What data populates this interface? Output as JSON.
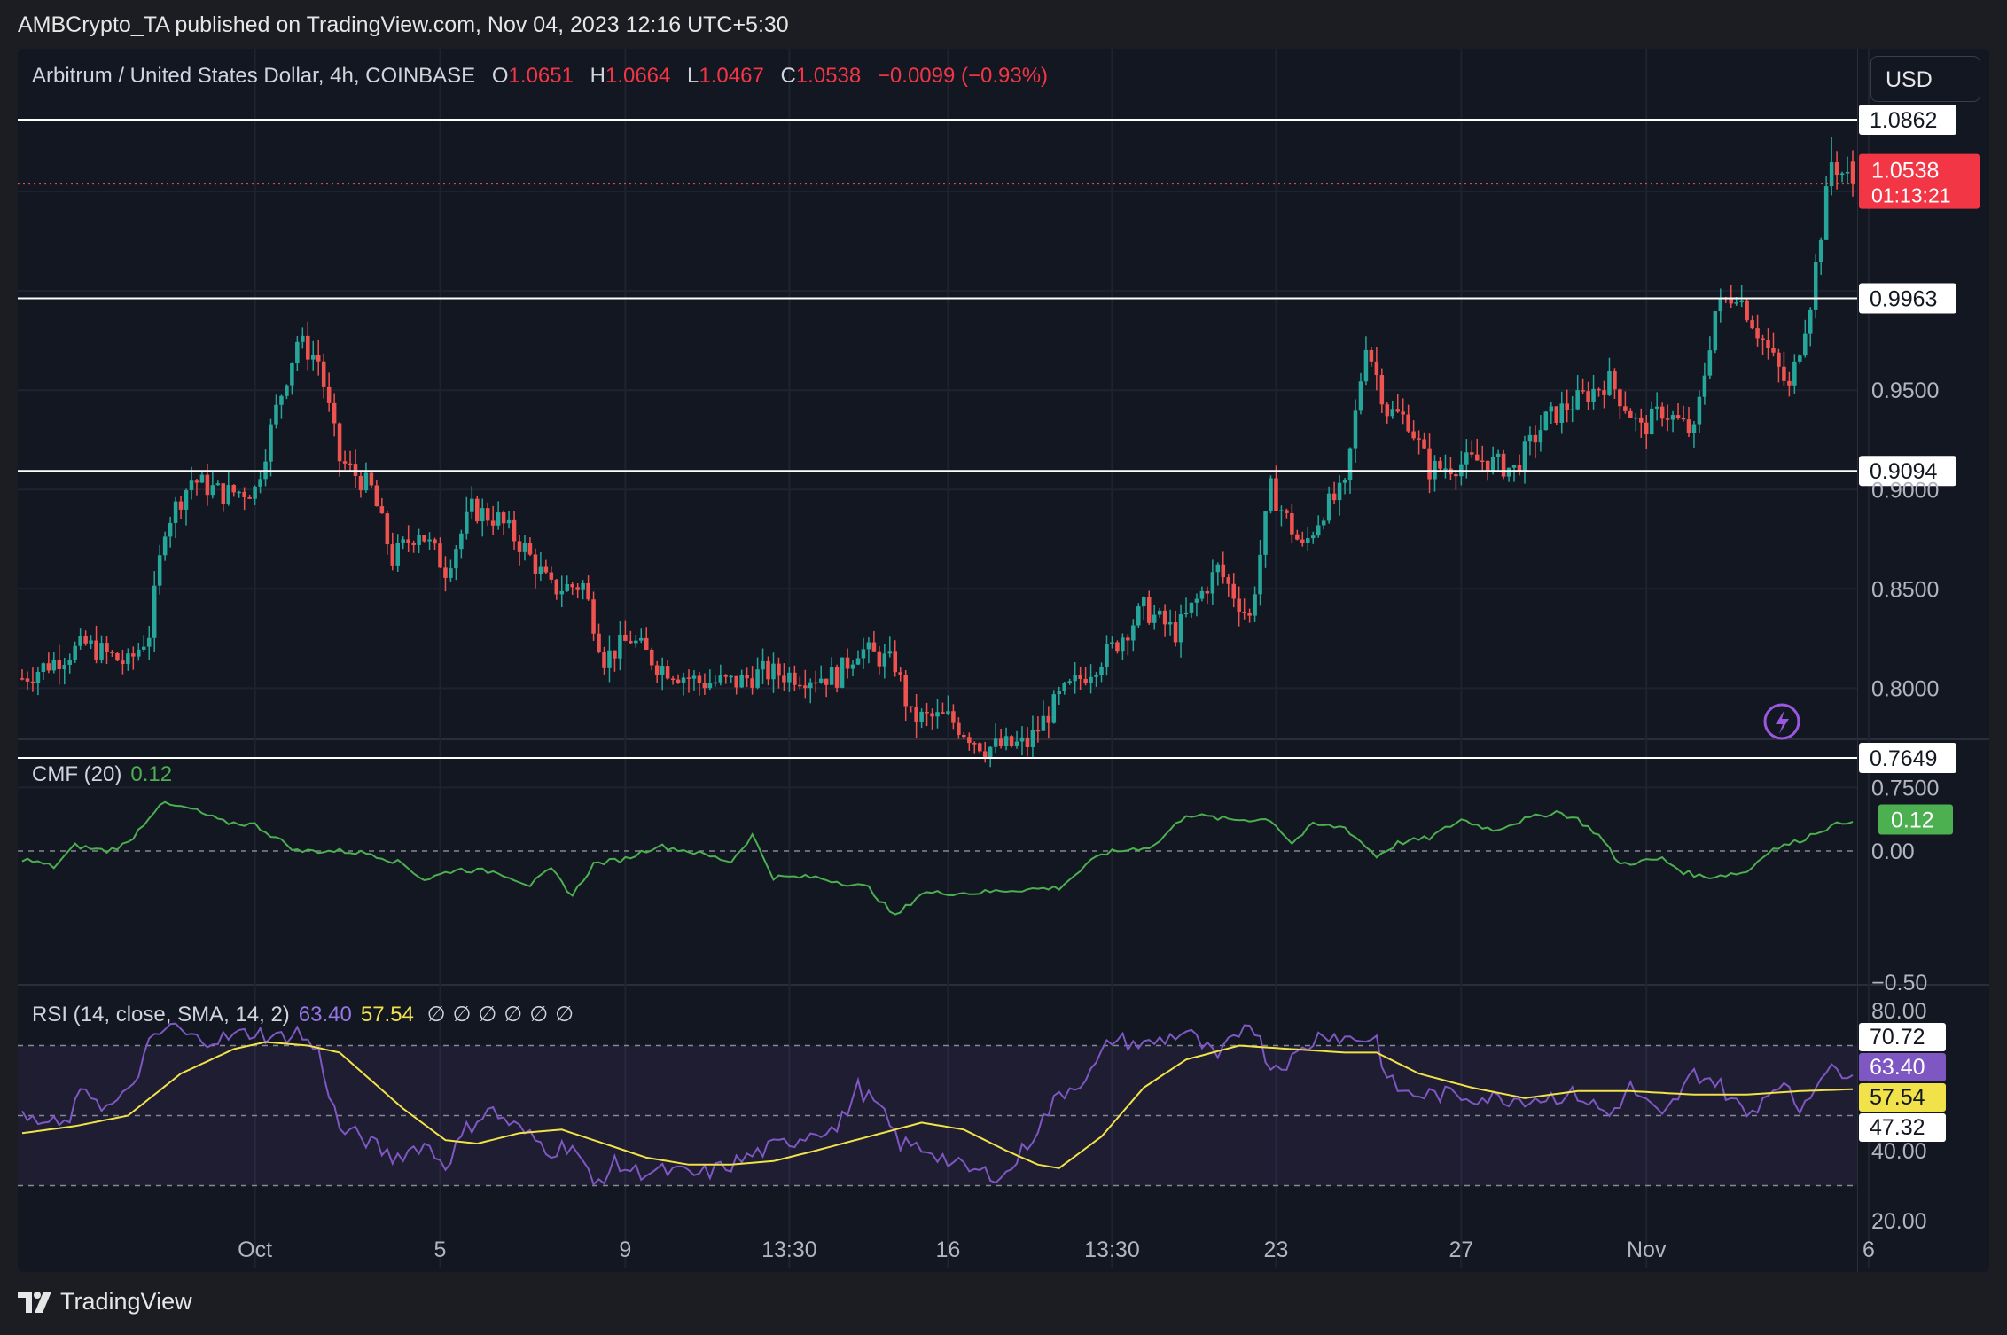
{
  "header": {
    "publisher": "AMBCrypto_TA published on TradingView.com, Nov 04, 2023 12:16 UTC+5:30"
  },
  "legend": {
    "symbol": "Arbitrum / United States Dollar, 4h, COINBASE",
    "open_label": "O",
    "open": "1.0651",
    "high_label": "H",
    "high": "1.0664",
    "low_label": "L",
    "low": "1.0467",
    "close_label": "C",
    "close": "1.0538",
    "change": "−0.0099 (−0.93%)"
  },
  "currency": "USD",
  "price_tag": {
    "price": "1.0538",
    "countdown": "01:13:21"
  },
  "levels": [
    "1.0862",
    "0.9963",
    "0.9094",
    "0.7649"
  ],
  "cmf": {
    "label": "CMF (20)",
    "value": "0.12",
    "axis": [
      "0.00",
      "−0.50"
    ]
  },
  "rsi": {
    "label": "RSI (14, close, SMA, 14, 2)",
    "value": "63.40",
    "sma": "57.54",
    "na_marks": [
      "∅",
      "∅",
      "∅",
      "∅",
      "∅",
      "∅"
    ],
    "tags": {
      "upper": "70.72",
      "rsi": "63.40",
      "sma": "57.54",
      "lower": "47.32"
    },
    "axis": [
      "80.00",
      "40.00",
      "20.00"
    ]
  },
  "footer": {
    "brand": "TradingView"
  },
  "colors": {
    "up": "#26a69a",
    "down": "#ef5350",
    "cmf": "#4caf50",
    "rsi": "#7e57c2",
    "sma": "#f2e24a",
    "bg": "#131722"
  },
  "chart_data": {
    "type": "candlestick",
    "interval": "4h",
    "y_ticks": [
      "0.7500",
      "0.8000",
      "0.8500",
      "0.9000",
      "0.9500"
    ],
    "x_ticks": [
      "Oct",
      "5",
      "9",
      "13:30",
      "16",
      "13:30",
      "23",
      "27",
      "Nov",
      "6"
    ],
    "price_range": [
      0.735,
      1.1
    ],
    "cmf_range": [
      -0.5,
      0.25
    ],
    "rsi_range": [
      20,
      80
    ],
    "key_levels": [
      1.0862,
      0.9963,
      0.9094,
      0.7649
    ],
    "close_path": [
      [
        0,
        0.805
      ],
      [
        12,
        0.822
      ],
      [
        20,
        0.812
      ],
      [
        24,
        0.828
      ],
      [
        27,
        0.882
      ],
      [
        32,
        0.905
      ],
      [
        38,
        0.898
      ],
      [
        44,
        0.9
      ],
      [
        48,
        0.94
      ],
      [
        52,
        0.975
      ],
      [
        56,
        0.965
      ],
      [
        60,
        0.915
      ],
      [
        66,
        0.9
      ],
      [
        70,
        0.865
      ],
      [
        75,
        0.88
      ],
      [
        80,
        0.86
      ],
      [
        85,
        0.89
      ],
      [
        90,
        0.885
      ],
      [
        95,
        0.87
      ],
      [
        100,
        0.85
      ],
      [
        106,
        0.852
      ],
      [
        110,
        0.815
      ],
      [
        115,
        0.825
      ],
      [
        120,
        0.812
      ],
      [
        128,
        0.803
      ],
      [
        135,
        0.803
      ],
      [
        140,
        0.808
      ],
      [
        148,
        0.806
      ],
      [
        154,
        0.806
      ],
      [
        158,
        0.82
      ],
      [
        165,
        0.812
      ],
      [
        168,
        0.785
      ],
      [
        175,
        0.785
      ],
      [
        182,
        0.77
      ],
      [
        190,
        0.772
      ],
      [
        196,
        0.795
      ],
      [
        206,
        0.82
      ],
      [
        212,
        0.84
      ],
      [
        218,
        0.828
      ],
      [
        226,
        0.86
      ],
      [
        232,
        0.835
      ],
      [
        236,
        0.9
      ],
      [
        242,
        0.87
      ],
      [
        246,
        0.89
      ],
      [
        250,
        0.9
      ],
      [
        254,
        0.975
      ],
      [
        258,
        0.94
      ],
      [
        262,
        0.935
      ],
      [
        266,
        0.91
      ],
      [
        270,
        0.912
      ],
      [
        276,
        0.915
      ],
      [
        282,
        0.91
      ],
      [
        288,
        0.935
      ],
      [
        294,
        0.945
      ],
      [
        300,
        0.955
      ],
      [
        306,
        0.93
      ],
      [
        310,
        0.94
      ],
      [
        316,
        0.928
      ],
      [
        320,
        0.99
      ],
      [
        324,
        1.0
      ],
      [
        328,
        0.98
      ],
      [
        334,
        0.95
      ],
      [
        338,
        0.995
      ],
      [
        342,
        1.065
      ],
      [
        346,
        1.0538
      ]
    ],
    "cmf_path": [
      [
        0,
        -0.03
      ],
      [
        6,
        -0.06
      ],
      [
        10,
        0.02
      ],
      [
        16,
        0.0
      ],
      [
        20,
        0.03
      ],
      [
        26,
        0.18
      ],
      [
        32,
        0.16
      ],
      [
        38,
        0.11
      ],
      [
        44,
        0.1
      ],
      [
        52,
        0.0
      ],
      [
        60,
        0.0
      ],
      [
        66,
        -0.01
      ],
      [
        72,
        -0.05
      ],
      [
        76,
        -0.11
      ],
      [
        82,
        -0.07
      ],
      [
        90,
        -0.08
      ],
      [
        96,
        -0.13
      ],
      [
        100,
        -0.07
      ],
      [
        104,
        -0.17
      ],
      [
        108,
        -0.05
      ],
      [
        114,
        -0.03
      ],
      [
        120,
        0.02
      ],
      [
        126,
        0.0
      ],
      [
        134,
        -0.04
      ],
      [
        138,
        0.06
      ],
      [
        142,
        -0.1
      ],
      [
        150,
        -0.1
      ],
      [
        160,
        -0.14
      ],
      [
        165,
        -0.25
      ],
      [
        170,
        -0.16
      ],
      [
        180,
        -0.16
      ],
      [
        186,
        -0.15
      ],
      [
        196,
        -0.14
      ],
      [
        204,
        -0.01
      ],
      [
        214,
        0.02
      ],
      [
        220,
        0.14
      ],
      [
        228,
        0.12
      ],
      [
        236,
        0.12
      ],
      [
        240,
        0.03
      ],
      [
        244,
        0.1
      ],
      [
        250,
        0.09
      ],
      [
        256,
        -0.02
      ],
      [
        260,
        0.03
      ],
      [
        266,
        0.05
      ],
      [
        272,
        0.12
      ],
      [
        278,
        0.08
      ],
      [
        284,
        0.12
      ],
      [
        290,
        0.15
      ],
      [
        294,
        0.12
      ],
      [
        298,
        0.06
      ],
      [
        302,
        -0.05
      ],
      [
        310,
        -0.03
      ],
      [
        314,
        -0.08
      ],
      [
        318,
        -0.1
      ],
      [
        326,
        -0.08
      ],
      [
        330,
        0.0
      ],
      [
        336,
        0.04
      ],
      [
        340,
        0.08
      ],
      [
        346,
        0.12
      ]
    ],
    "rsi_path": [
      [
        0,
        49
      ],
      [
        8,
        47
      ],
      [
        12,
        58
      ],
      [
        16,
        52
      ],
      [
        20,
        56
      ],
      [
        24,
        70
      ],
      [
        28,
        76
      ],
      [
        32,
        72
      ],
      [
        38,
        72
      ],
      [
        44,
        74
      ],
      [
        48,
        72
      ],
      [
        52,
        74
      ],
      [
        56,
        68
      ],
      [
        60,
        46
      ],
      [
        64,
        44
      ],
      [
        70,
        38
      ],
      [
        76,
        42
      ],
      [
        80,
        36
      ],
      [
        84,
        46
      ],
      [
        88,
        52
      ],
      [
        94,
        46
      ],
      [
        100,
        40
      ],
      [
        104,
        42
      ],
      [
        108,
        30
      ],
      [
        112,
        36
      ],
      [
        116,
        34
      ],
      [
        122,
        34
      ],
      [
        128,
        33
      ],
      [
        134,
        36
      ],
      [
        140,
        40
      ],
      [
        146,
        43
      ],
      [
        150,
        46
      ],
      [
        154,
        46
      ],
      [
        158,
        58
      ],
      [
        162,
        52
      ],
      [
        166,
        42
      ],
      [
        172,
        40
      ],
      [
        176,
        36
      ],
      [
        180,
        34
      ],
      [
        186,
        33
      ],
      [
        190,
        42
      ],
      [
        196,
        56
      ],
      [
        202,
        62
      ],
      [
        206,
        72
      ],
      [
        212,
        70
      ],
      [
        216,
        72
      ],
      [
        220,
        74
      ],
      [
        226,
        66
      ],
      [
        232,
        78
      ],
      [
        236,
        64
      ],
      [
        240,
        66
      ],
      [
        246,
        74
      ],
      [
        250,
        72
      ],
      [
        256,
        72
      ],
      [
        258,
        60
      ],
      [
        262,
        56
      ],
      [
        270,
        56
      ],
      [
        278,
        55
      ],
      [
        286,
        55
      ],
      [
        294,
        56
      ],
      [
        300,
        50
      ],
      [
        304,
        58
      ],
      [
        310,
        49
      ],
      [
        316,
        62
      ],
      [
        320,
        60
      ],
      [
        326,
        50
      ],
      [
        332,
        60
      ],
      [
        336,
        52
      ],
      [
        340,
        62
      ],
      [
        346,
        63.4
      ]
    ],
    "sma_path": [
      [
        0,
        45
      ],
      [
        10,
        47
      ],
      [
        20,
        50
      ],
      [
        30,
        62
      ],
      [
        40,
        69
      ],
      [
        46,
        71
      ],
      [
        54,
        70
      ],
      [
        60,
        68
      ],
      [
        66,
        60
      ],
      [
        72,
        52
      ],
      [
        80,
        43
      ],
      [
        86,
        42
      ],
      [
        94,
        45
      ],
      [
        102,
        46
      ],
      [
        110,
        42
      ],
      [
        118,
        38
      ],
      [
        126,
        36
      ],
      [
        134,
        36
      ],
      [
        142,
        37
      ],
      [
        150,
        40
      ],
      [
        160,
        44
      ],
      [
        170,
        48
      ],
      [
        178,
        46
      ],
      [
        186,
        40
      ],
      [
        192,
        36
      ],
      [
        196,
        35
      ],
      [
        204,
        44
      ],
      [
        212,
        58
      ],
      [
        220,
        66
      ],
      [
        230,
        70
      ],
      [
        240,
        69
      ],
      [
        250,
        68
      ],
      [
        256,
        68
      ],
      [
        264,
        62
      ],
      [
        274,
        58
      ],
      [
        284,
        55
      ],
      [
        294,
        57
      ],
      [
        304,
        57
      ],
      [
        316,
        56
      ],
      [
        326,
        56
      ],
      [
        336,
        57
      ],
      [
        346,
        57.54
      ]
    ]
  }
}
